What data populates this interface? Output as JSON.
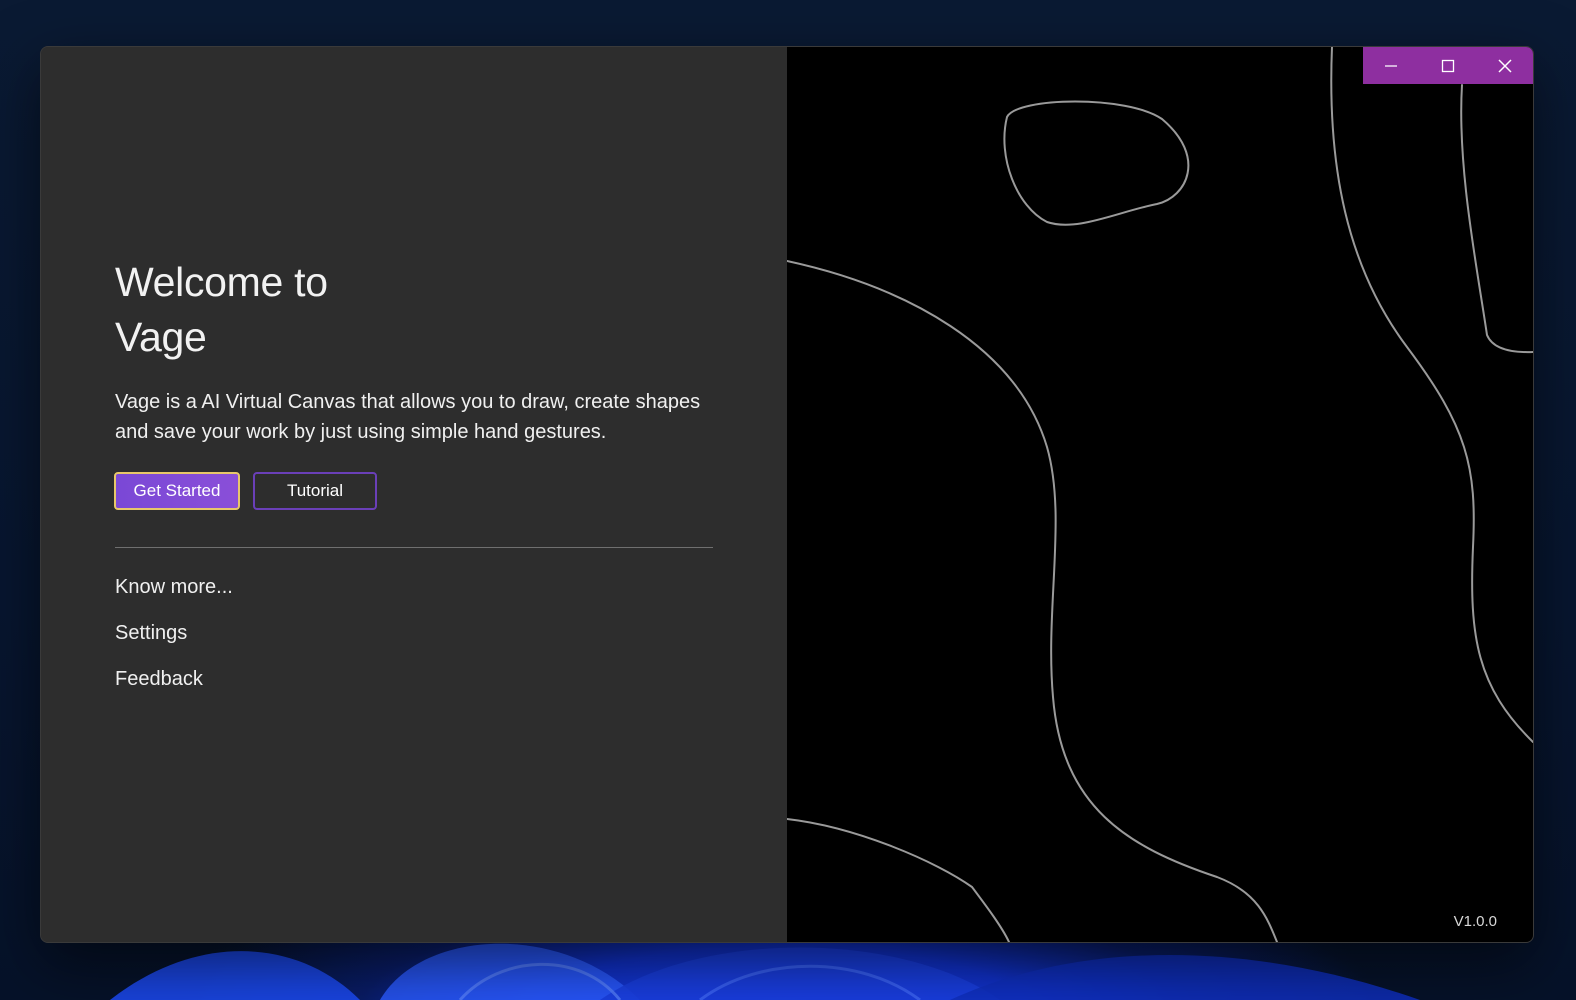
{
  "app": {
    "title_line1": "Welcome to",
    "title_line2": "Vage",
    "description": "Vage is a AI Virtual Canvas that allows you to draw, create shapes and save your work by just using simple hand gestures.",
    "version": "V1.0.0"
  },
  "actions": {
    "get_started_label": "Get Started",
    "tutorial_label": "Tutorial"
  },
  "links": {
    "know_more": "Know more...",
    "settings": "Settings",
    "feedback": "Feedback"
  },
  "window_controls": {
    "minimize_icon": "minimize-icon",
    "maximize_icon": "maximize-icon",
    "close_icon": "close-icon"
  },
  "colors": {
    "accent": "#8e2fa0",
    "primary_button": "#7a48d6",
    "focus_ring": "#e8c76a",
    "panel_bg": "#2d2d2d",
    "canvas_bg": "#000000"
  }
}
